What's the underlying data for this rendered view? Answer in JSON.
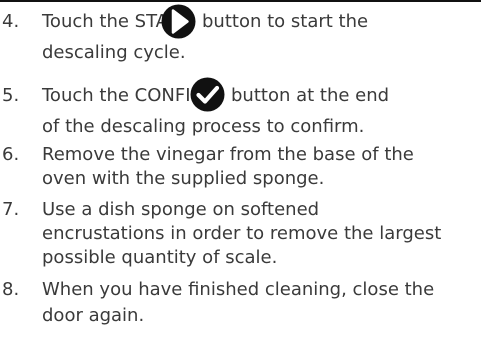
{
  "steps": [
    {
      "number": "4.",
      "before_icon": "Touch the START",
      "icon": "play-icon",
      "after_icon": "button to start the",
      "line2": "descaling cycle."
    },
    {
      "number": "5.",
      "before_icon": "Touch the CONFIRM",
      "icon": "checkmark-icon",
      "after_icon": "button at the end",
      "line2": "of the descaling process to confirm."
    },
    {
      "number": "6.",
      "lines": [
        "Remove the vinegar from the base of the",
        "oven with the supplied sponge."
      ]
    },
    {
      "number": "7.",
      "lines": [
        "Use a dish sponge on softened",
        "encrustations in order to remove the largest",
        "possible quantity of scale."
      ]
    },
    {
      "number": "8.",
      "lines": [
        "When you have finished cleaning, close the",
        "door again."
      ]
    }
  ],
  "colors": {
    "text": "#3a3a3a",
    "icon_fill": "#111111",
    "icon_symbol": "#ffffff"
  }
}
